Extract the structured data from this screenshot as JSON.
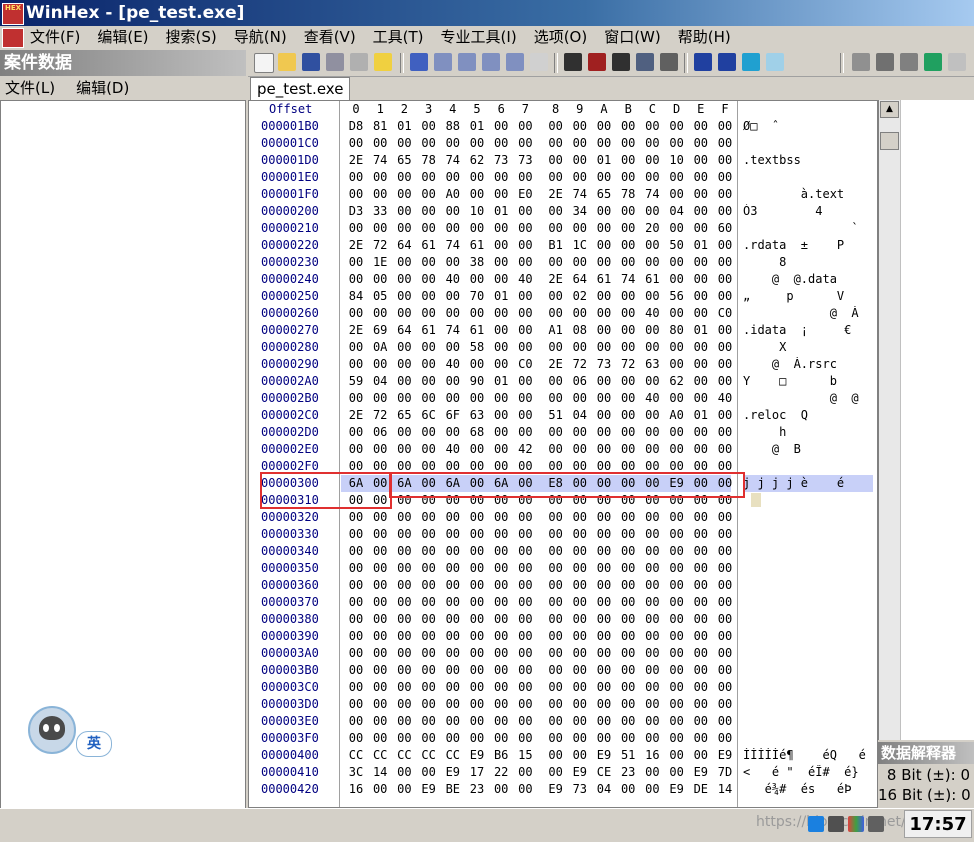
{
  "window": {
    "title": "WinHex - [pe_test.exe]",
    "app_icon_text": "HEX"
  },
  "menubar": {
    "items": [
      "文件(F)",
      "编辑(E)",
      "搜索(S)",
      "导航(N)",
      "查看(V)",
      "工具(T)",
      "专业工具(I)",
      "选项(O)",
      "窗口(W)",
      "帮助(H)"
    ]
  },
  "left_panel": {
    "title": "案件数据",
    "menu": [
      "文件(L)",
      "编辑(D)"
    ]
  },
  "ime": {
    "label": "英"
  },
  "tab": {
    "label": "pe_test.exe"
  },
  "hex_view": {
    "offset_header": "Offset",
    "columns": [
      "0",
      "1",
      "2",
      "3",
      "4",
      "5",
      "6",
      "7",
      "8",
      "9",
      "A",
      "B",
      "C",
      "D",
      "E",
      "F"
    ],
    "rows": [
      {
        "offset": "000001B0",
        "bytes": [
          "D8",
          "81",
          "01",
          "00",
          "88",
          "01",
          "00",
          "00",
          "00",
          "00",
          "00",
          "00",
          "00",
          "00",
          "00",
          "00"
        ],
        "ascii": "Ø□  ˆ"
      },
      {
        "offset": "000001C0",
        "bytes": [
          "00",
          "00",
          "00",
          "00",
          "00",
          "00",
          "00",
          "00",
          "00",
          "00",
          "00",
          "00",
          "00",
          "00",
          "00",
          "00"
        ],
        "ascii": ""
      },
      {
        "offset": "000001D0",
        "bytes": [
          "2E",
          "74",
          "65",
          "78",
          "74",
          "62",
          "73",
          "73",
          "00",
          "00",
          "01",
          "00",
          "00",
          "10",
          "00",
          "00"
        ],
        "ascii": ".textbss"
      },
      {
        "offset": "000001E0",
        "bytes": [
          "00",
          "00",
          "00",
          "00",
          "00",
          "00",
          "00",
          "00",
          "00",
          "00",
          "00",
          "00",
          "00",
          "00",
          "00",
          "00"
        ],
        "ascii": ""
      },
      {
        "offset": "000001F0",
        "bytes": [
          "00",
          "00",
          "00",
          "00",
          "A0",
          "00",
          "00",
          "E0",
          "2E",
          "74",
          "65",
          "78",
          "74",
          "00",
          "00",
          "00"
        ],
        "ascii": "        à.text"
      },
      {
        "offset": "00000200",
        "bytes": [
          "D3",
          "33",
          "00",
          "00",
          "00",
          "10",
          "01",
          "00",
          "00",
          "34",
          "00",
          "00",
          "00",
          "04",
          "00",
          "00"
        ],
        "ascii": "Ó3        4"
      },
      {
        "offset": "00000210",
        "bytes": [
          "00",
          "00",
          "00",
          "00",
          "00",
          "00",
          "00",
          "00",
          "00",
          "00",
          "00",
          "00",
          "20",
          "00",
          "00",
          "60"
        ],
        "ascii": "               `"
      },
      {
        "offset": "00000220",
        "bytes": [
          "2E",
          "72",
          "64",
          "61",
          "74",
          "61",
          "00",
          "00",
          "B1",
          "1C",
          "00",
          "00",
          "00",
          "50",
          "01",
          "00"
        ],
        "ascii": ".rdata  ±    P"
      },
      {
        "offset": "00000230",
        "bytes": [
          "00",
          "1E",
          "00",
          "00",
          "00",
          "38",
          "00",
          "00",
          "00",
          "00",
          "00",
          "00",
          "00",
          "00",
          "00",
          "00"
        ],
        "ascii": "     8"
      },
      {
        "offset": "00000240",
        "bytes": [
          "00",
          "00",
          "00",
          "00",
          "40",
          "00",
          "00",
          "40",
          "2E",
          "64",
          "61",
          "74",
          "61",
          "00",
          "00",
          "00"
        ],
        "ascii": "    @  @.data"
      },
      {
        "offset": "00000250",
        "bytes": [
          "84",
          "05",
          "00",
          "00",
          "00",
          "70",
          "01",
          "00",
          "00",
          "02",
          "00",
          "00",
          "00",
          "56",
          "00",
          "00"
        ],
        "ascii": "„     p      V"
      },
      {
        "offset": "00000260",
        "bytes": [
          "00",
          "00",
          "00",
          "00",
          "00",
          "00",
          "00",
          "00",
          "00",
          "00",
          "00",
          "00",
          "40",
          "00",
          "00",
          "C0"
        ],
        "ascii": "            @  À"
      },
      {
        "offset": "00000270",
        "bytes": [
          "2E",
          "69",
          "64",
          "61",
          "74",
          "61",
          "00",
          "00",
          "A1",
          "08",
          "00",
          "00",
          "00",
          "80",
          "01",
          "00"
        ],
        "ascii": ".idata  ¡     €"
      },
      {
        "offset": "00000280",
        "bytes": [
          "00",
          "0A",
          "00",
          "00",
          "00",
          "58",
          "00",
          "00",
          "00",
          "00",
          "00",
          "00",
          "00",
          "00",
          "00",
          "00"
        ],
        "ascii": "     X"
      },
      {
        "offset": "00000290",
        "bytes": [
          "00",
          "00",
          "00",
          "00",
          "40",
          "00",
          "00",
          "C0",
          "2E",
          "72",
          "73",
          "72",
          "63",
          "00",
          "00",
          "00"
        ],
        "ascii": "    @  À.rsrc"
      },
      {
        "offset": "000002A0",
        "bytes": [
          "59",
          "04",
          "00",
          "00",
          "00",
          "90",
          "01",
          "00",
          "00",
          "06",
          "00",
          "00",
          "00",
          "62",
          "00",
          "00"
        ],
        "ascii": "Y    □      b"
      },
      {
        "offset": "000002B0",
        "bytes": [
          "00",
          "00",
          "00",
          "00",
          "00",
          "00",
          "00",
          "00",
          "00",
          "00",
          "00",
          "00",
          "40",
          "00",
          "00",
          "40"
        ],
        "ascii": "            @  @"
      },
      {
        "offset": "000002C0",
        "bytes": [
          "2E",
          "72",
          "65",
          "6C",
          "6F",
          "63",
          "00",
          "00",
          "51",
          "04",
          "00",
          "00",
          "00",
          "A0",
          "01",
          "00"
        ],
        "ascii": ".reloc  Q"
      },
      {
        "offset": "000002D0",
        "bytes": [
          "00",
          "06",
          "00",
          "00",
          "00",
          "68",
          "00",
          "00",
          "00",
          "00",
          "00",
          "00",
          "00",
          "00",
          "00",
          "00"
        ],
        "ascii": "     h"
      },
      {
        "offset": "000002E0",
        "bytes": [
          "00",
          "00",
          "00",
          "00",
          "40",
          "00",
          "00",
          "42",
          "00",
          "00",
          "00",
          "00",
          "00",
          "00",
          "00",
          "00"
        ],
        "ascii": "    @  B"
      },
      {
        "offset": "000002F0",
        "bytes": [
          "00",
          "00",
          "00",
          "00",
          "00",
          "00",
          "00",
          "00",
          "00",
          "00",
          "00",
          "00",
          "00",
          "00",
          "00",
          "00"
        ],
        "ascii": ""
      },
      {
        "offset": "00000300",
        "bytes": [
          "6A",
          "00",
          "6A",
          "00",
          "6A",
          "00",
          "6A",
          "00",
          "E8",
          "00",
          "00",
          "00",
          "00",
          "E9",
          "00",
          "00"
        ],
        "ascii": "j j j j è    é"
      },
      {
        "offset": "00000310",
        "bytes": [
          "00",
          "00",
          "00",
          "00",
          "00",
          "00",
          "00",
          "00",
          "00",
          "00",
          "00",
          "00",
          "00",
          "00",
          "00",
          "00"
        ],
        "ascii": ""
      },
      {
        "offset": "00000320",
        "bytes": [
          "00",
          "00",
          "00",
          "00",
          "00",
          "00",
          "00",
          "00",
          "00",
          "00",
          "00",
          "00",
          "00",
          "00",
          "00",
          "00"
        ],
        "ascii": ""
      },
      {
        "offset": "00000330",
        "bytes": [
          "00",
          "00",
          "00",
          "00",
          "00",
          "00",
          "00",
          "00",
          "00",
          "00",
          "00",
          "00",
          "00",
          "00",
          "00",
          "00"
        ],
        "ascii": ""
      },
      {
        "offset": "00000340",
        "bytes": [
          "00",
          "00",
          "00",
          "00",
          "00",
          "00",
          "00",
          "00",
          "00",
          "00",
          "00",
          "00",
          "00",
          "00",
          "00",
          "00"
        ],
        "ascii": ""
      },
      {
        "offset": "00000350",
        "bytes": [
          "00",
          "00",
          "00",
          "00",
          "00",
          "00",
          "00",
          "00",
          "00",
          "00",
          "00",
          "00",
          "00",
          "00",
          "00",
          "00"
        ],
        "ascii": ""
      },
      {
        "offset": "00000360",
        "bytes": [
          "00",
          "00",
          "00",
          "00",
          "00",
          "00",
          "00",
          "00",
          "00",
          "00",
          "00",
          "00",
          "00",
          "00",
          "00",
          "00"
        ],
        "ascii": ""
      },
      {
        "offset": "00000370",
        "bytes": [
          "00",
          "00",
          "00",
          "00",
          "00",
          "00",
          "00",
          "00",
          "00",
          "00",
          "00",
          "00",
          "00",
          "00",
          "00",
          "00"
        ],
        "ascii": ""
      },
      {
        "offset": "00000380",
        "bytes": [
          "00",
          "00",
          "00",
          "00",
          "00",
          "00",
          "00",
          "00",
          "00",
          "00",
          "00",
          "00",
          "00",
          "00",
          "00",
          "00"
        ],
        "ascii": ""
      },
      {
        "offset": "00000390",
        "bytes": [
          "00",
          "00",
          "00",
          "00",
          "00",
          "00",
          "00",
          "00",
          "00",
          "00",
          "00",
          "00",
          "00",
          "00",
          "00",
          "00"
        ],
        "ascii": ""
      },
      {
        "offset": "000003A0",
        "bytes": [
          "00",
          "00",
          "00",
          "00",
          "00",
          "00",
          "00",
          "00",
          "00",
          "00",
          "00",
          "00",
          "00",
          "00",
          "00",
          "00"
        ],
        "ascii": ""
      },
      {
        "offset": "000003B0",
        "bytes": [
          "00",
          "00",
          "00",
          "00",
          "00",
          "00",
          "00",
          "00",
          "00",
          "00",
          "00",
          "00",
          "00",
          "00",
          "00",
          "00"
        ],
        "ascii": ""
      },
      {
        "offset": "000003C0",
        "bytes": [
          "00",
          "00",
          "00",
          "00",
          "00",
          "00",
          "00",
          "00",
          "00",
          "00",
          "00",
          "00",
          "00",
          "00",
          "00",
          "00"
        ],
        "ascii": ""
      },
      {
        "offset": "000003D0",
        "bytes": [
          "00",
          "00",
          "00",
          "00",
          "00",
          "00",
          "00",
          "00",
          "00",
          "00",
          "00",
          "00",
          "00",
          "00",
          "00",
          "00"
        ],
        "ascii": ""
      },
      {
        "offset": "000003E0",
        "bytes": [
          "00",
          "00",
          "00",
          "00",
          "00",
          "00",
          "00",
          "00",
          "00",
          "00",
          "00",
          "00",
          "00",
          "00",
          "00",
          "00"
        ],
        "ascii": ""
      },
      {
        "offset": "000003F0",
        "bytes": [
          "00",
          "00",
          "00",
          "00",
          "00",
          "00",
          "00",
          "00",
          "00",
          "00",
          "00",
          "00",
          "00",
          "00",
          "00",
          "00"
        ],
        "ascii": ""
      },
      {
        "offset": "00000400",
        "bytes": [
          "CC",
          "CC",
          "CC",
          "CC",
          "CC",
          "E9",
          "B6",
          "15",
          "00",
          "00",
          "E9",
          "51",
          "16",
          "00",
          "00",
          "E9"
        ],
        "ascii": "ÌÌÌÌÌé¶    éQ   é"
      },
      {
        "offset": "00000410",
        "bytes": [
          "3C",
          "14",
          "00",
          "00",
          "E9",
          "17",
          "22",
          "00",
          "00",
          "E9",
          "CE",
          "23",
          "00",
          "00",
          "E9",
          "7D"
        ],
        "ascii": "<   é \"  éÎ#  é}"
      },
      {
        "offset": "00000420",
        "bytes": [
          "16",
          "00",
          "00",
          "E9",
          "BE",
          "23",
          "00",
          "00",
          "E9",
          "73",
          "04",
          "00",
          "00",
          "E9",
          "DE",
          "14"
        ],
        "ascii": "   é¾#  és   éÞ"
      }
    ]
  },
  "data_interpreter": {
    "title": "数据解释器",
    "rows": [
      {
        "label": "8 Bit (±):",
        "value": "0"
      },
      {
        "label": "16 Bit (±):",
        "value": "0"
      }
    ]
  },
  "statusbar": {
    "watermark": "https://blog.csdn.net/HJ...",
    "clock": "17:57"
  },
  "colors": {
    "title_gradient_start": "#0a246a",
    "selection_highlight": "#c8d0f8",
    "annotation_red": "#e03030",
    "offset_text": "#000080"
  }
}
